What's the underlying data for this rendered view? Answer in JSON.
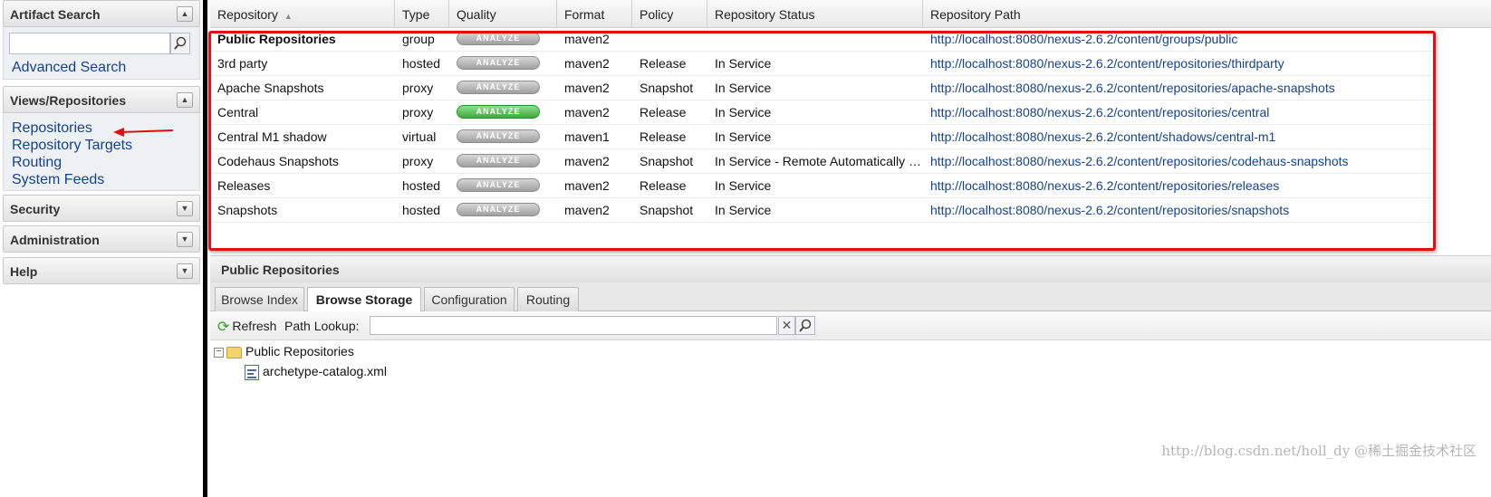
{
  "sidebar": {
    "artifact_search": {
      "title": "Artifact Search",
      "search_placeholder": "",
      "advanced_link": "Advanced Search"
    },
    "views": {
      "title": "Views/Repositories",
      "items": [
        "Repositories",
        "Repository Targets",
        "Routing",
        "System Feeds"
      ]
    },
    "security": {
      "title": "Security"
    },
    "administration": {
      "title": "Administration"
    },
    "help": {
      "title": "Help"
    }
  },
  "grid": {
    "columns": [
      "Repository",
      "Type",
      "Quality",
      "Format",
      "Policy",
      "Repository Status",
      "Repository Path"
    ],
    "rows": [
      {
        "name": "Public Repositories",
        "type": "group",
        "quality": "ANALYZE",
        "format": "maven2",
        "policy": "",
        "status": "",
        "path": "http://localhost:8080/nexus-2.6.2/content/groups/public"
      },
      {
        "name": "3rd party",
        "type": "hosted",
        "quality": "ANALYZE",
        "format": "maven2",
        "policy": "Release",
        "status": "In Service",
        "path": "http://localhost:8080/nexus-2.6.2/content/repositories/thirdparty"
      },
      {
        "name": "Apache Snapshots",
        "type": "proxy",
        "quality": "ANALYZE",
        "format": "maven2",
        "policy": "Snapshot",
        "status": "In Service",
        "path": "http://localhost:8080/nexus-2.6.2/content/repositories/apache-snapshots"
      },
      {
        "name": "Central",
        "type": "proxy",
        "quality": "ANALYZE",
        "format": "maven2",
        "policy": "Release",
        "status": "In Service",
        "path": "http://localhost:8080/nexus-2.6.2/content/repositories/central"
      },
      {
        "name": "Central M1 shadow",
        "type": "virtual",
        "quality": "ANALYZE",
        "format": "maven1",
        "policy": "Release",
        "status": "In Service",
        "path": "http://localhost:8080/nexus-2.6.2/content/shadows/central-m1"
      },
      {
        "name": "Codehaus Snapshots",
        "type": "proxy",
        "quality": "ANALYZE",
        "format": "maven2",
        "policy": "Snapshot",
        "status": "In Service - Remote Automatically Bl...",
        "path": "http://localhost:8080/nexus-2.6.2/content/repositories/codehaus-snapshots"
      },
      {
        "name": "Releases",
        "type": "hosted",
        "quality": "ANALYZE",
        "format": "maven2",
        "policy": "Release",
        "status": "In Service",
        "path": "http://localhost:8080/nexus-2.6.2/content/repositories/releases"
      },
      {
        "name": "Snapshots",
        "type": "hosted",
        "quality": "ANALYZE",
        "format": "maven2",
        "policy": "Snapshot",
        "status": "In Service",
        "path": "http://localhost:8080/nexus-2.6.2/content/repositories/snapshots"
      }
    ]
  },
  "detail": {
    "title": "Public Repositories",
    "tabs": [
      "Browse Index",
      "Browse Storage",
      "Configuration",
      "Routing"
    ],
    "active_tab": "Browse Storage",
    "toolbar": {
      "refresh": "Refresh",
      "path_lookup": "Path Lookup:",
      "path_value": ""
    },
    "tree": {
      "root": "Public Repositories",
      "children": [
        "archetype-catalog.xml"
      ]
    }
  },
  "watermark": "http://blog.csdn.net/holl_dy  @稀土掘金技术社区",
  "colors": {
    "accent_link": "#15428b",
    "highlight": "#dd1111",
    "analyze_good": "#3da93d"
  }
}
